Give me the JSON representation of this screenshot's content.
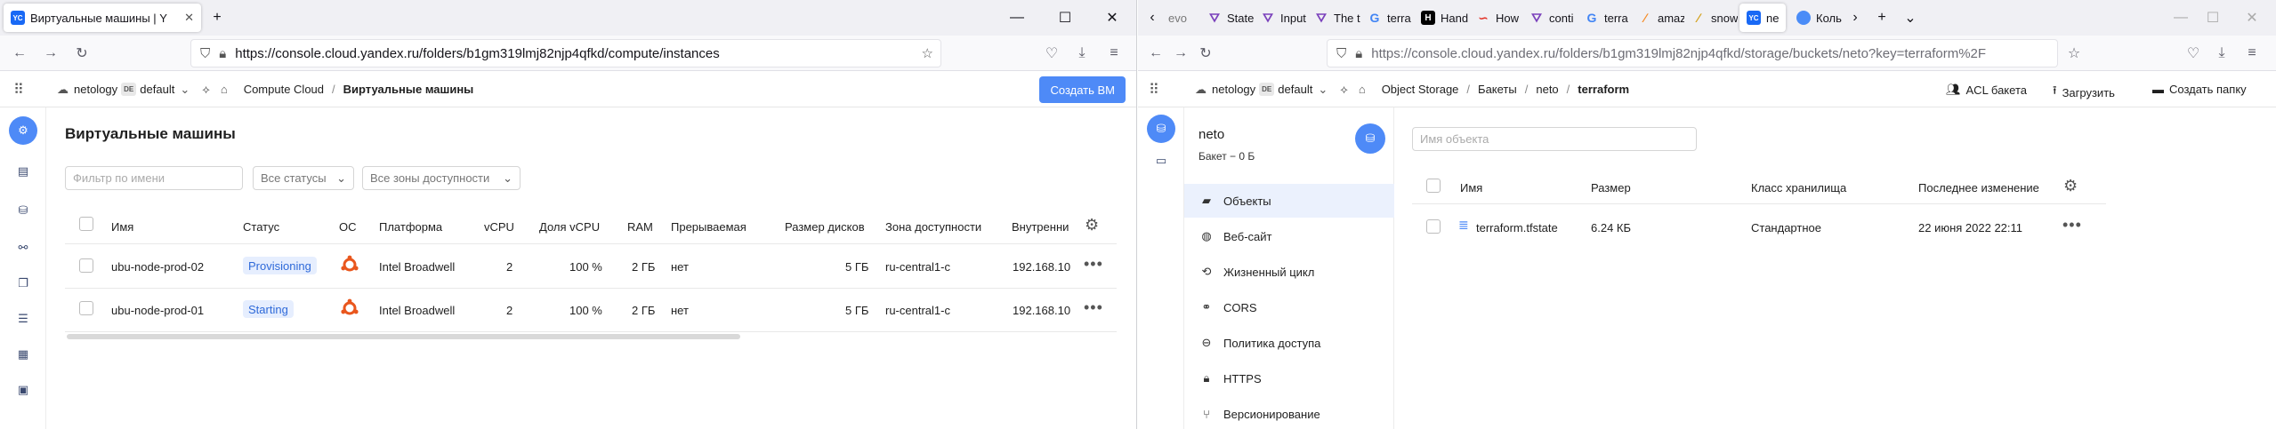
{
  "left": {
    "tab": {
      "title": "Виртуальные машины | Y",
      "favicon": "YC"
    },
    "url": "https://console.cloud.yandex.ru/folders/b1gm319lmj82njp4qfkd/compute/instances",
    "breadcrumb": {
      "org": "netology",
      "cloud_badge": "DE",
      "folder": "default",
      "service": "Compute Cloud",
      "page": "Виртуальные машины"
    },
    "create_button": "Создать ВМ",
    "page_title": "Виртуальные машины",
    "filters": {
      "name_placeholder": "Фильтр по имени",
      "status": "Все статусы",
      "zones": "Все зоны доступности"
    },
    "columns": [
      "Имя",
      "Статус",
      "ОС",
      "Платформа",
      "vCPU",
      "Доля vCPU",
      "RAM",
      "Прерываемая",
      "Размер дисков",
      "Зона доступности",
      "Внутренни"
    ],
    "rows": [
      {
        "name": "ubu-node-prod-02",
        "status": "Provisioning",
        "os": "ubuntu",
        "platform": "Intel Broadwell",
        "vcpu": "2",
        "share": "100 %",
        "ram": "2 ГБ",
        "preemptible": "нет",
        "disk": "5 ГБ",
        "zone": "ru-central1-c",
        "ip": "192.168.10"
      },
      {
        "name": "ubu-node-prod-01",
        "status": "Starting",
        "os": "ubuntu",
        "platform": "Intel Broadwell",
        "vcpu": "2",
        "share": "100 %",
        "ram": "2 ГБ",
        "preemptible": "нет",
        "disk": "5 ГБ",
        "zone": "ru-central1-c",
        "ip": "192.168.10"
      }
    ]
  },
  "right": {
    "tabs": [
      "evo",
      "State",
      "Input",
      "The t",
      "terra",
      "Hand",
      "How",
      "conti",
      "terra",
      "amaz",
      "snow",
      "ne",
      "Коль"
    ],
    "url": "https://console.cloud.yandex.ru/folders/b1gm319lmj82njp4qfkd/storage/buckets/neto?key=terraform%2F",
    "breadcrumb": {
      "org": "netology",
      "cloud_badge": "DE",
      "folder": "default",
      "service": "Object Storage",
      "buckets": "Бакеты",
      "bucket": "neto",
      "path": "terraform"
    },
    "actions": {
      "acl": "ACL бакета",
      "upload": "Загрузить",
      "create_folder": "Создать папку"
    },
    "bucket": {
      "name": "neto",
      "size": "Бакет − 0 Б"
    },
    "menu": [
      "Объекты",
      "Веб-сайт",
      "Жизненный цикл",
      "CORS",
      "Политика доступа",
      "HTTPS",
      "Версионирование"
    ],
    "object_placeholder": "Имя объекта",
    "columns": [
      "Имя",
      "Размер",
      "Класс хранилища",
      "Последнее изменение"
    ],
    "rows": [
      {
        "name": "terraform.tfstate",
        "size": "6.24 КБ",
        "class": "Стандартное",
        "modified": "22 июня 2022 22:11"
      }
    ]
  }
}
